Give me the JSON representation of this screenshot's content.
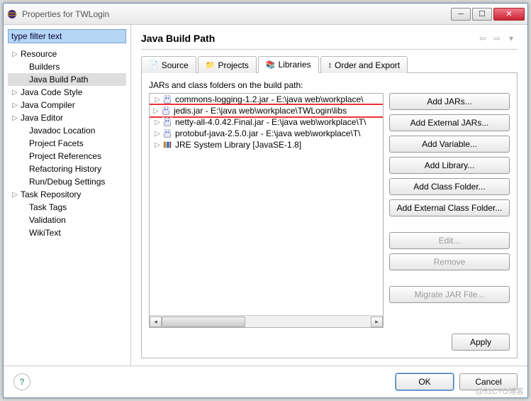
{
  "window": {
    "title": "Properties for TWLogin"
  },
  "filter": {
    "placeholder": "type filter text"
  },
  "tree": [
    {
      "label": "Resource",
      "expandable": true,
      "level": 0
    },
    {
      "label": "Builders",
      "level": 1
    },
    {
      "label": "Java Build Path",
      "level": 1,
      "selected": true
    },
    {
      "label": "Java Code Style",
      "expandable": true,
      "level": 0
    },
    {
      "label": "Java Compiler",
      "expandable": true,
      "level": 0
    },
    {
      "label": "Java Editor",
      "expandable": true,
      "level": 0
    },
    {
      "label": "Javadoc Location",
      "level": 1
    },
    {
      "label": "Project Facets",
      "level": 1
    },
    {
      "label": "Project References",
      "level": 1
    },
    {
      "label": "Refactoring History",
      "level": 1
    },
    {
      "label": "Run/Debug Settings",
      "level": 1
    },
    {
      "label": "Task Repository",
      "expandable": true,
      "level": 0
    },
    {
      "label": "Task Tags",
      "level": 1
    },
    {
      "label": "Validation",
      "level": 1
    },
    {
      "label": "WikiText",
      "level": 1
    }
  ],
  "page": {
    "title": "Java Build Path"
  },
  "tabs": [
    {
      "label": "Source"
    },
    {
      "label": "Projects"
    },
    {
      "label": "Libraries",
      "active": true
    },
    {
      "label": "Order and Export"
    }
  ],
  "libraries": {
    "description": "JARs and class folders on the build path:",
    "items": [
      {
        "label": "commons-logging-1.2.jar - E:\\java web\\workplace\\",
        "kind": "jar"
      },
      {
        "label": "jedis.jar - E:\\java web\\workplace\\TWLogin\\libs",
        "kind": "jar",
        "highlight": true
      },
      {
        "label": "netty-all-4.0.42.Final.jar - E:\\java web\\workplace\\T\\",
        "kind": "jar"
      },
      {
        "label": "protobuf-java-2.5.0.jar - E:\\java web\\workplace\\T\\",
        "kind": "jar"
      },
      {
        "label": "JRE System Library [JavaSE-1.8]",
        "kind": "lib"
      }
    ]
  },
  "buttons": {
    "addJars": "Add JARs...",
    "addExternalJars": "Add External JARs...",
    "addVariable": "Add Variable...",
    "addLibrary": "Add Library...",
    "addClassFolder": "Add Class Folder...",
    "addExternalClassFolder": "Add External Class Folder...",
    "edit": "Edit...",
    "remove": "Remove",
    "migrate": "Migrate JAR File...",
    "apply": "Apply",
    "ok": "OK",
    "cancel": "Cancel"
  },
  "watermark": "@51CTO博客"
}
